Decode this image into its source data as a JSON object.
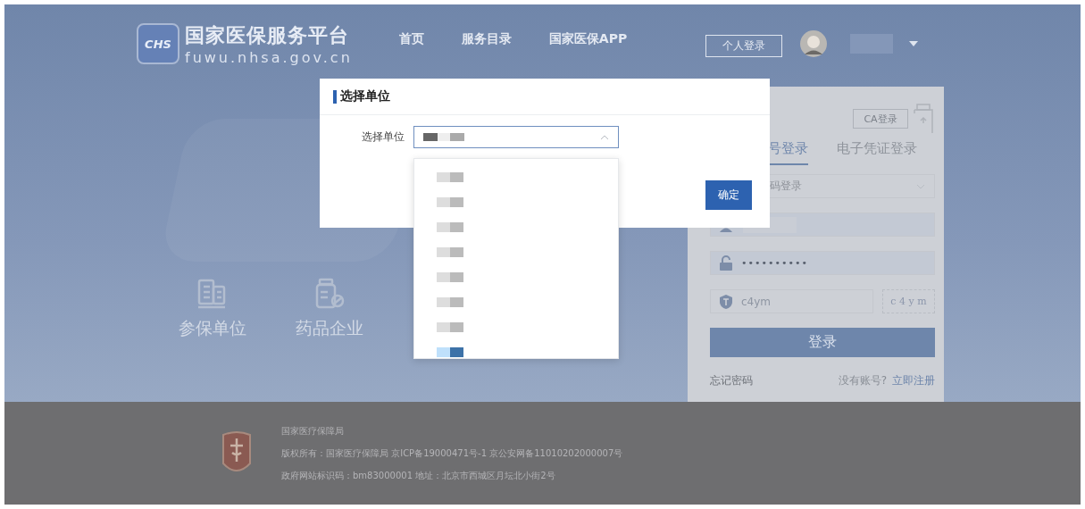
{
  "header": {
    "logo_badge": "CHS",
    "site_title": "国家医保服务平台",
    "site_domain": "fuwu.nhsa.gov.cn",
    "nav": [
      {
        "label": "首页"
      },
      {
        "label": "服务目录"
      },
      {
        "label": "国家医保APP"
      }
    ],
    "login_button": "个人登录"
  },
  "hero": {
    "entries": [
      {
        "kind": "company",
        "label": "参保单位"
      },
      {
        "kind": "pharma",
        "label": "药品企业"
      }
    ]
  },
  "login_card": {
    "ca_button": "CA登录",
    "tabs": [
      {
        "label": "号登录",
        "selected": true
      },
      {
        "label": "电子凭证登录",
        "selected": false
      }
    ],
    "mode_select": "码登录",
    "password": "••••••••••",
    "captcha_value": "c4ym",
    "captcha_image": "c 4 y m",
    "submit": "登录",
    "forgot": "忘记密码",
    "no_account": "没有账号?",
    "register": "立即注册"
  },
  "dialog": {
    "title": "选择单位",
    "field_label": "选择单位",
    "confirm": "确定",
    "dropdown_open": true,
    "options": [
      {
        "selected": false
      },
      {
        "selected": false
      },
      {
        "selected": false
      },
      {
        "selected": false
      },
      {
        "selected": false
      },
      {
        "selected": false
      },
      {
        "selected": false
      },
      {
        "selected": true
      }
    ]
  },
  "footer": {
    "lines": [
      "国家医疗保障局",
      "版权所有：国家医疗保障局  京ICP备19000471号-1  京公安网备11010202000007号",
      "政府网站标识码：bm83000001  地址：北京市西城区月坛北小街2号"
    ]
  }
}
